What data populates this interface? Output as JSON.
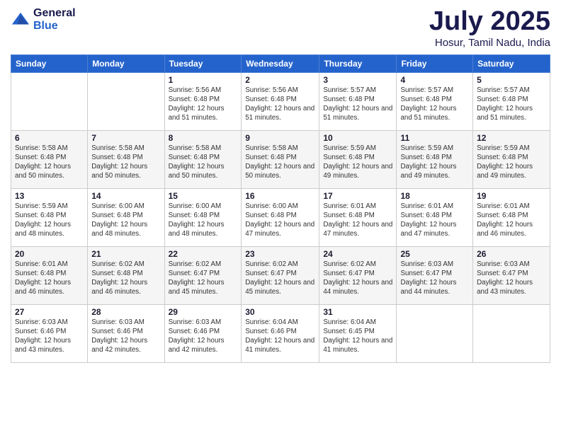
{
  "logo": {
    "general": "General",
    "blue": "Blue"
  },
  "header": {
    "month": "July 2025",
    "location": "Hosur, Tamil Nadu, India"
  },
  "weekdays": [
    "Sunday",
    "Monday",
    "Tuesday",
    "Wednesday",
    "Thursday",
    "Friday",
    "Saturday"
  ],
  "weeks": [
    [
      {
        "day": "",
        "info": ""
      },
      {
        "day": "",
        "info": ""
      },
      {
        "day": "1",
        "info": "Sunrise: 5:56 AM\nSunset: 6:48 PM\nDaylight: 12 hours and 51 minutes."
      },
      {
        "day": "2",
        "info": "Sunrise: 5:56 AM\nSunset: 6:48 PM\nDaylight: 12 hours and 51 minutes."
      },
      {
        "day": "3",
        "info": "Sunrise: 5:57 AM\nSunset: 6:48 PM\nDaylight: 12 hours and 51 minutes."
      },
      {
        "day": "4",
        "info": "Sunrise: 5:57 AM\nSunset: 6:48 PM\nDaylight: 12 hours and 51 minutes."
      },
      {
        "day": "5",
        "info": "Sunrise: 5:57 AM\nSunset: 6:48 PM\nDaylight: 12 hours and 51 minutes."
      }
    ],
    [
      {
        "day": "6",
        "info": "Sunrise: 5:58 AM\nSunset: 6:48 PM\nDaylight: 12 hours and 50 minutes."
      },
      {
        "day": "7",
        "info": "Sunrise: 5:58 AM\nSunset: 6:48 PM\nDaylight: 12 hours and 50 minutes."
      },
      {
        "day": "8",
        "info": "Sunrise: 5:58 AM\nSunset: 6:48 PM\nDaylight: 12 hours and 50 minutes."
      },
      {
        "day": "9",
        "info": "Sunrise: 5:58 AM\nSunset: 6:48 PM\nDaylight: 12 hours and 50 minutes."
      },
      {
        "day": "10",
        "info": "Sunrise: 5:59 AM\nSunset: 6:48 PM\nDaylight: 12 hours and 49 minutes."
      },
      {
        "day": "11",
        "info": "Sunrise: 5:59 AM\nSunset: 6:48 PM\nDaylight: 12 hours and 49 minutes."
      },
      {
        "day": "12",
        "info": "Sunrise: 5:59 AM\nSunset: 6:48 PM\nDaylight: 12 hours and 49 minutes."
      }
    ],
    [
      {
        "day": "13",
        "info": "Sunrise: 5:59 AM\nSunset: 6:48 PM\nDaylight: 12 hours and 48 minutes."
      },
      {
        "day": "14",
        "info": "Sunrise: 6:00 AM\nSunset: 6:48 PM\nDaylight: 12 hours and 48 minutes."
      },
      {
        "day": "15",
        "info": "Sunrise: 6:00 AM\nSunset: 6:48 PM\nDaylight: 12 hours and 48 minutes."
      },
      {
        "day": "16",
        "info": "Sunrise: 6:00 AM\nSunset: 6:48 PM\nDaylight: 12 hours and 47 minutes."
      },
      {
        "day": "17",
        "info": "Sunrise: 6:01 AM\nSunset: 6:48 PM\nDaylight: 12 hours and 47 minutes."
      },
      {
        "day": "18",
        "info": "Sunrise: 6:01 AM\nSunset: 6:48 PM\nDaylight: 12 hours and 47 minutes."
      },
      {
        "day": "19",
        "info": "Sunrise: 6:01 AM\nSunset: 6:48 PM\nDaylight: 12 hours and 46 minutes."
      }
    ],
    [
      {
        "day": "20",
        "info": "Sunrise: 6:01 AM\nSunset: 6:48 PM\nDaylight: 12 hours and 46 minutes."
      },
      {
        "day": "21",
        "info": "Sunrise: 6:02 AM\nSunset: 6:48 PM\nDaylight: 12 hours and 46 minutes."
      },
      {
        "day": "22",
        "info": "Sunrise: 6:02 AM\nSunset: 6:47 PM\nDaylight: 12 hours and 45 minutes."
      },
      {
        "day": "23",
        "info": "Sunrise: 6:02 AM\nSunset: 6:47 PM\nDaylight: 12 hours and 45 minutes."
      },
      {
        "day": "24",
        "info": "Sunrise: 6:02 AM\nSunset: 6:47 PM\nDaylight: 12 hours and 44 minutes."
      },
      {
        "day": "25",
        "info": "Sunrise: 6:03 AM\nSunset: 6:47 PM\nDaylight: 12 hours and 44 minutes."
      },
      {
        "day": "26",
        "info": "Sunrise: 6:03 AM\nSunset: 6:47 PM\nDaylight: 12 hours and 43 minutes."
      }
    ],
    [
      {
        "day": "27",
        "info": "Sunrise: 6:03 AM\nSunset: 6:46 PM\nDaylight: 12 hours and 43 minutes."
      },
      {
        "day": "28",
        "info": "Sunrise: 6:03 AM\nSunset: 6:46 PM\nDaylight: 12 hours and 42 minutes."
      },
      {
        "day": "29",
        "info": "Sunrise: 6:03 AM\nSunset: 6:46 PM\nDaylight: 12 hours and 42 minutes."
      },
      {
        "day": "30",
        "info": "Sunrise: 6:04 AM\nSunset: 6:46 PM\nDaylight: 12 hours and 41 minutes."
      },
      {
        "day": "31",
        "info": "Sunrise: 6:04 AM\nSunset: 6:45 PM\nDaylight: 12 hours and 41 minutes."
      },
      {
        "day": "",
        "info": ""
      },
      {
        "day": "",
        "info": ""
      }
    ]
  ]
}
